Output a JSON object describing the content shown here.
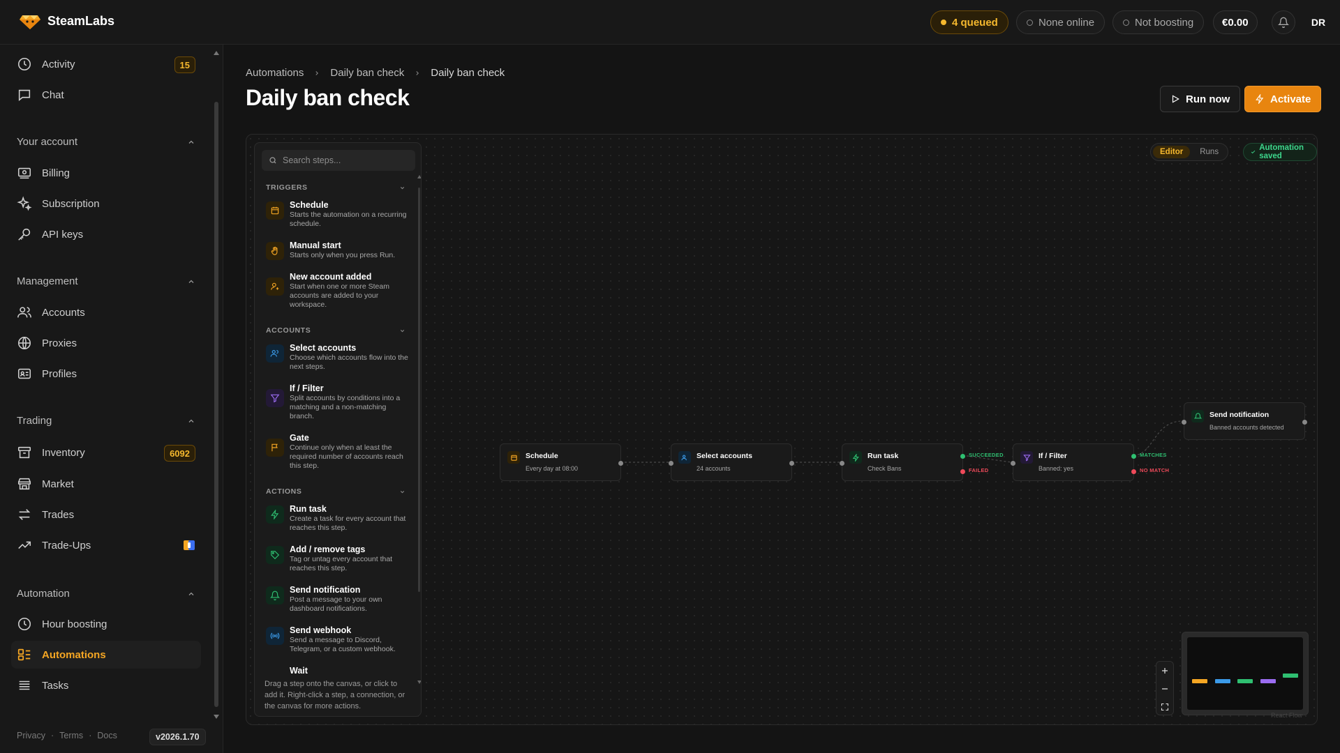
{
  "brand": {
    "name": "SteamLabs"
  },
  "topbar": {
    "queued": "4 queued",
    "online": "None online",
    "boosting": "Not boosting",
    "balance": "€0.00",
    "avatar_initials": "DR"
  },
  "sidebar": {
    "top_items": [
      {
        "label": "Activity",
        "badge": "15"
      },
      {
        "label": "Chat"
      }
    ],
    "sections": [
      {
        "title": "Your account",
        "items": [
          {
            "label": "Billing"
          },
          {
            "label": "Subscription"
          },
          {
            "label": "API keys"
          }
        ]
      },
      {
        "title": "Management",
        "items": [
          {
            "label": "Accounts"
          },
          {
            "label": "Proxies"
          },
          {
            "label": "Profiles"
          }
        ]
      },
      {
        "title": "Trading",
        "items": [
          {
            "label": "Inventory",
            "badge": "6092"
          },
          {
            "label": "Market"
          },
          {
            "label": "Trades"
          },
          {
            "label": "Trade-Ups"
          }
        ]
      },
      {
        "title": "Automation",
        "items": [
          {
            "label": "Hour boosting"
          },
          {
            "label": "Automations",
            "active": true
          },
          {
            "label": "Tasks"
          }
        ]
      }
    ],
    "footer": {
      "privacy": "Privacy",
      "terms": "Terms",
      "docs": "Docs",
      "version": "v2026.1.70"
    }
  },
  "breadcrumb": [
    "Automations",
    "Daily ban check",
    "Daily ban check"
  ],
  "page_title": "Daily ban check",
  "actions": {
    "run_now": "Run now",
    "activate": "Activate"
  },
  "canvas": {
    "view_tabs": {
      "editor": "Editor",
      "runs": "Runs"
    },
    "saved_status": "Automation saved",
    "footer_hint": "Drag a step onto the canvas, or click to add it. Right-click a step, a connection, or the canvas for more actions.",
    "attribution": "React Flow"
  },
  "palette": {
    "search_placeholder": "Search steps...",
    "groups": [
      {
        "title": "TRIGGERS",
        "items": [
          {
            "title": "Schedule",
            "desc": "Starts the automation on a recurring schedule.",
            "icon": "calendar-icon",
            "color": "#f5a623"
          },
          {
            "title": "Manual start",
            "desc": "Starts only when you press Run.",
            "icon": "hand-icon",
            "color": "#f5a623"
          },
          {
            "title": "New account added",
            "desc": "Start when one or more Steam accounts are added to your workspace.",
            "icon": "user-plus-icon",
            "color": "#f5a623"
          }
        ]
      },
      {
        "title": "ACCOUNTS",
        "items": [
          {
            "title": "Select accounts",
            "desc": "Choose which accounts flow into the next steps.",
            "icon": "users-icon",
            "color": "#3b9ae8"
          },
          {
            "title": "If / Filter",
            "desc": "Split accounts by conditions into a matching and a non-matching branch.",
            "icon": "filter-icon",
            "color": "#9b6cf0"
          },
          {
            "title": "Gate",
            "desc": "Continue only when at least the required number of accounts reach this step.",
            "icon": "flag-icon",
            "color": "#f5a623"
          }
        ]
      },
      {
        "title": "ACTIONS",
        "items": [
          {
            "title": "Run task",
            "desc": "Create a task for every account that reaches this step.",
            "icon": "bolt-icon",
            "color": "#2fbf71"
          },
          {
            "title": "Add / remove tags",
            "desc": "Tag or untag every account that reaches this step.",
            "icon": "tag-icon",
            "color": "#2fbf71"
          },
          {
            "title": "Send notification",
            "desc": "Post a message to your own dashboard notifications.",
            "icon": "bell-icon",
            "color": "#2fbf71"
          },
          {
            "title": "Send webhook",
            "desc": "Send a message to Discord, Telegram, or a custom webhook.",
            "icon": "broadcast-icon",
            "color": "#3b9ae8"
          },
          {
            "title": "Wait",
            "desc": "",
            "icon": "clock-icon",
            "color": "#f5a623"
          }
        ]
      }
    ]
  },
  "flow": {
    "nodes": [
      {
        "id": "schedule",
        "title": "Schedule",
        "subtitle": "Every day at 08:00",
        "icon": "calendar-icon",
        "color": "#f5a623"
      },
      {
        "id": "select",
        "title": "Select accounts",
        "subtitle": "24 accounts",
        "icon": "users-icon",
        "color": "#3b9ae8"
      },
      {
        "id": "run",
        "title": "Run task",
        "subtitle": "Check Bans",
        "icon": "bolt-icon",
        "color": "#2fbf71"
      },
      {
        "id": "filter",
        "title": "If / Filter",
        "subtitle": "Banned: yes",
        "icon": "filter-icon",
        "color": "#9b6cf0"
      },
      {
        "id": "notify",
        "title": "Send notification",
        "subtitle": "Banned accounts detected",
        "icon": "bell-icon",
        "color": "#2fbf71"
      }
    ],
    "handles": {
      "succeeded": "SUCCEEDED",
      "failed": "FAILED",
      "matches": "MATCHES",
      "no_match": "NO MATCH"
    }
  },
  "colors": {
    "accent": "#e8850f",
    "success": "#2fbf71",
    "danger": "#ef4a5a",
    "info": "#3b9ae8",
    "purple": "#9b6cf0"
  }
}
